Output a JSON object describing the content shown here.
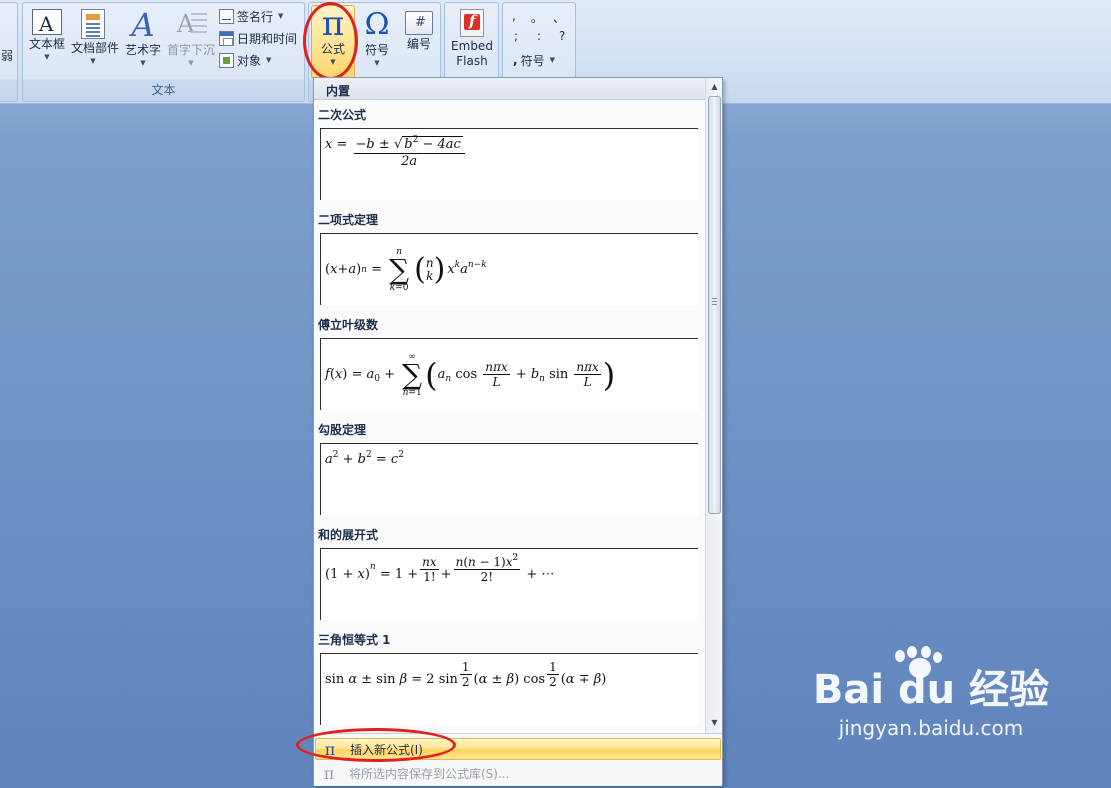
{
  "ribbon": {
    "partial_left_label": "弱",
    "text_group": {
      "label": "文本",
      "textbox_label": "文本框",
      "doc_parts_label": "文档部件",
      "wordart_label": "艺术字",
      "dropcap_label": "首字下沉",
      "signature_label": "签名行",
      "datetime_label": "日期和时间",
      "object_label": "对象"
    },
    "symbols_group": {
      "equation_label": "公式",
      "symbol_label": "符号",
      "number_label": "编号"
    },
    "flash_group": {
      "line1": "Embed",
      "line2": "Flash"
    },
    "special_group": {
      "punct": [
        ",",
        "。",
        "、",
        ";",
        ":",
        "?"
      ],
      "symbol_label": "符号"
    }
  },
  "dropdown": {
    "header": "内置",
    "equations": [
      {
        "title": "二次公式"
      },
      {
        "title": "二项式定理"
      },
      {
        "title": "傅立叶级数"
      },
      {
        "title": "勾股定理"
      },
      {
        "title": "和的展开式"
      },
      {
        "title": "三角恒等式 1"
      }
    ],
    "insert_new": "插入新公式(I)",
    "save_selection": "将所选内容保存到公式库(S)..."
  },
  "watermark": {
    "logo": "Bai du 经验",
    "url": "jingyan.baidu.com"
  },
  "colors": {
    "highlight_oval": "#e0201c",
    "accent_blue": "#1e4fb4"
  }
}
